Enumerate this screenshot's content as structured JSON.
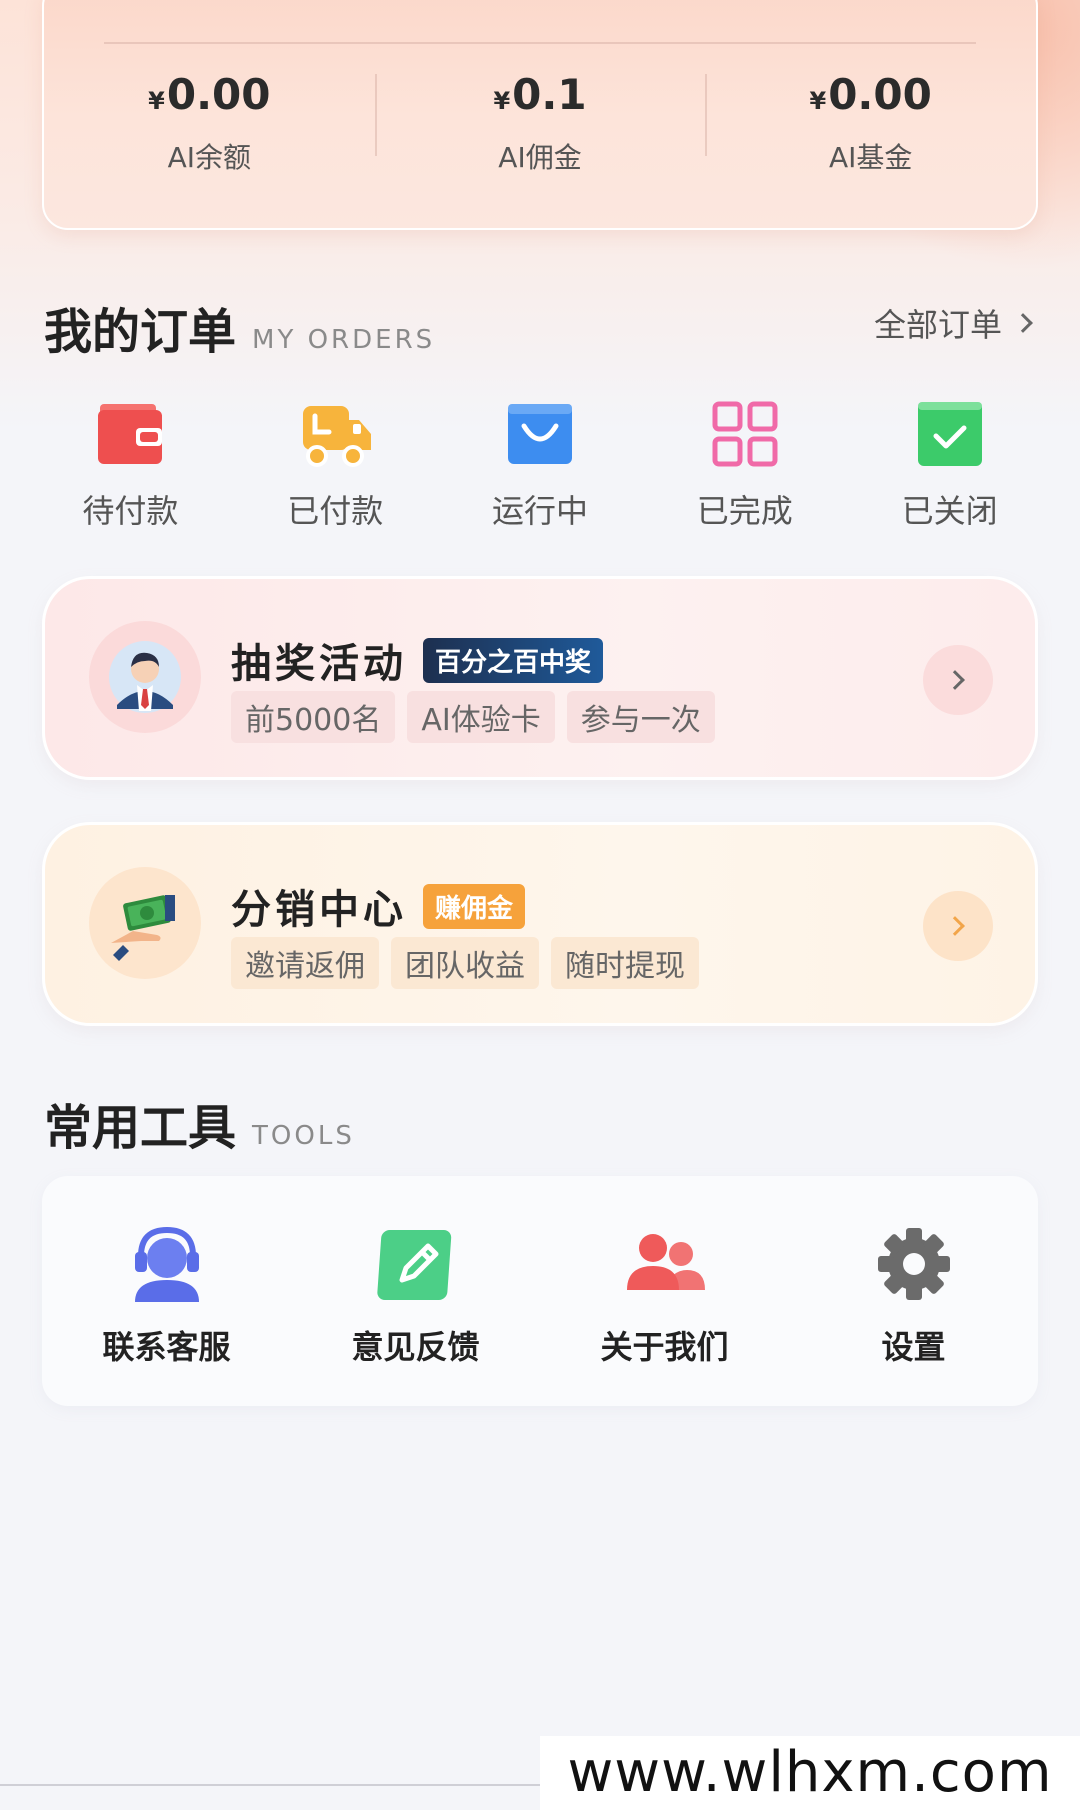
{
  "wallet": {
    "stats": [
      {
        "currency": "¥",
        "value": "0.00",
        "label": "AI余额"
      },
      {
        "currency": "¥",
        "value": "0.1",
        "label": "AI佣金"
      },
      {
        "currency": "¥",
        "value": "0.00",
        "label": "AI基金"
      }
    ]
  },
  "orders": {
    "title": "我的订单",
    "subtitle": "MY ORDERS",
    "all_link": "全部订单",
    "items": [
      {
        "label": "待付款",
        "icon": "wallet-icon",
        "color": "#ee4f4f"
      },
      {
        "label": "已付款",
        "icon": "delivery-truck-icon",
        "color": "#f7b43c"
      },
      {
        "label": "运行中",
        "icon": "shopping-bag-icon",
        "color": "#3d8df0"
      },
      {
        "label": "已完成",
        "icon": "grid-icon",
        "color": "#f06aa8"
      },
      {
        "label": "已关闭",
        "icon": "check-box-icon",
        "color": "#3ccb6a"
      }
    ]
  },
  "lottery": {
    "title": "抽奖活动",
    "badge": "百分之百中奖",
    "tags": [
      "前5000名",
      "AI体验卡",
      "参与一次"
    ]
  },
  "distribution": {
    "title": "分销中心",
    "badge": "赚佣金",
    "tags": [
      "邀请返佣",
      "团队收益",
      "随时提现"
    ]
  },
  "tools": {
    "title": "常用工具",
    "subtitle": "TOOLS",
    "items": [
      {
        "label": "联系客服",
        "icon": "customer-service-icon",
        "color": "#5a6de8"
      },
      {
        "label": "意见反馈",
        "icon": "feedback-edit-icon",
        "color": "#4ccf87"
      },
      {
        "label": "关于我们",
        "icon": "users-icon",
        "color": "#ef5a5a"
      },
      {
        "label": "设置",
        "icon": "settings-gear-icon",
        "color": "#6b6b6b"
      }
    ]
  },
  "watermark": "www.wlhxm.com"
}
